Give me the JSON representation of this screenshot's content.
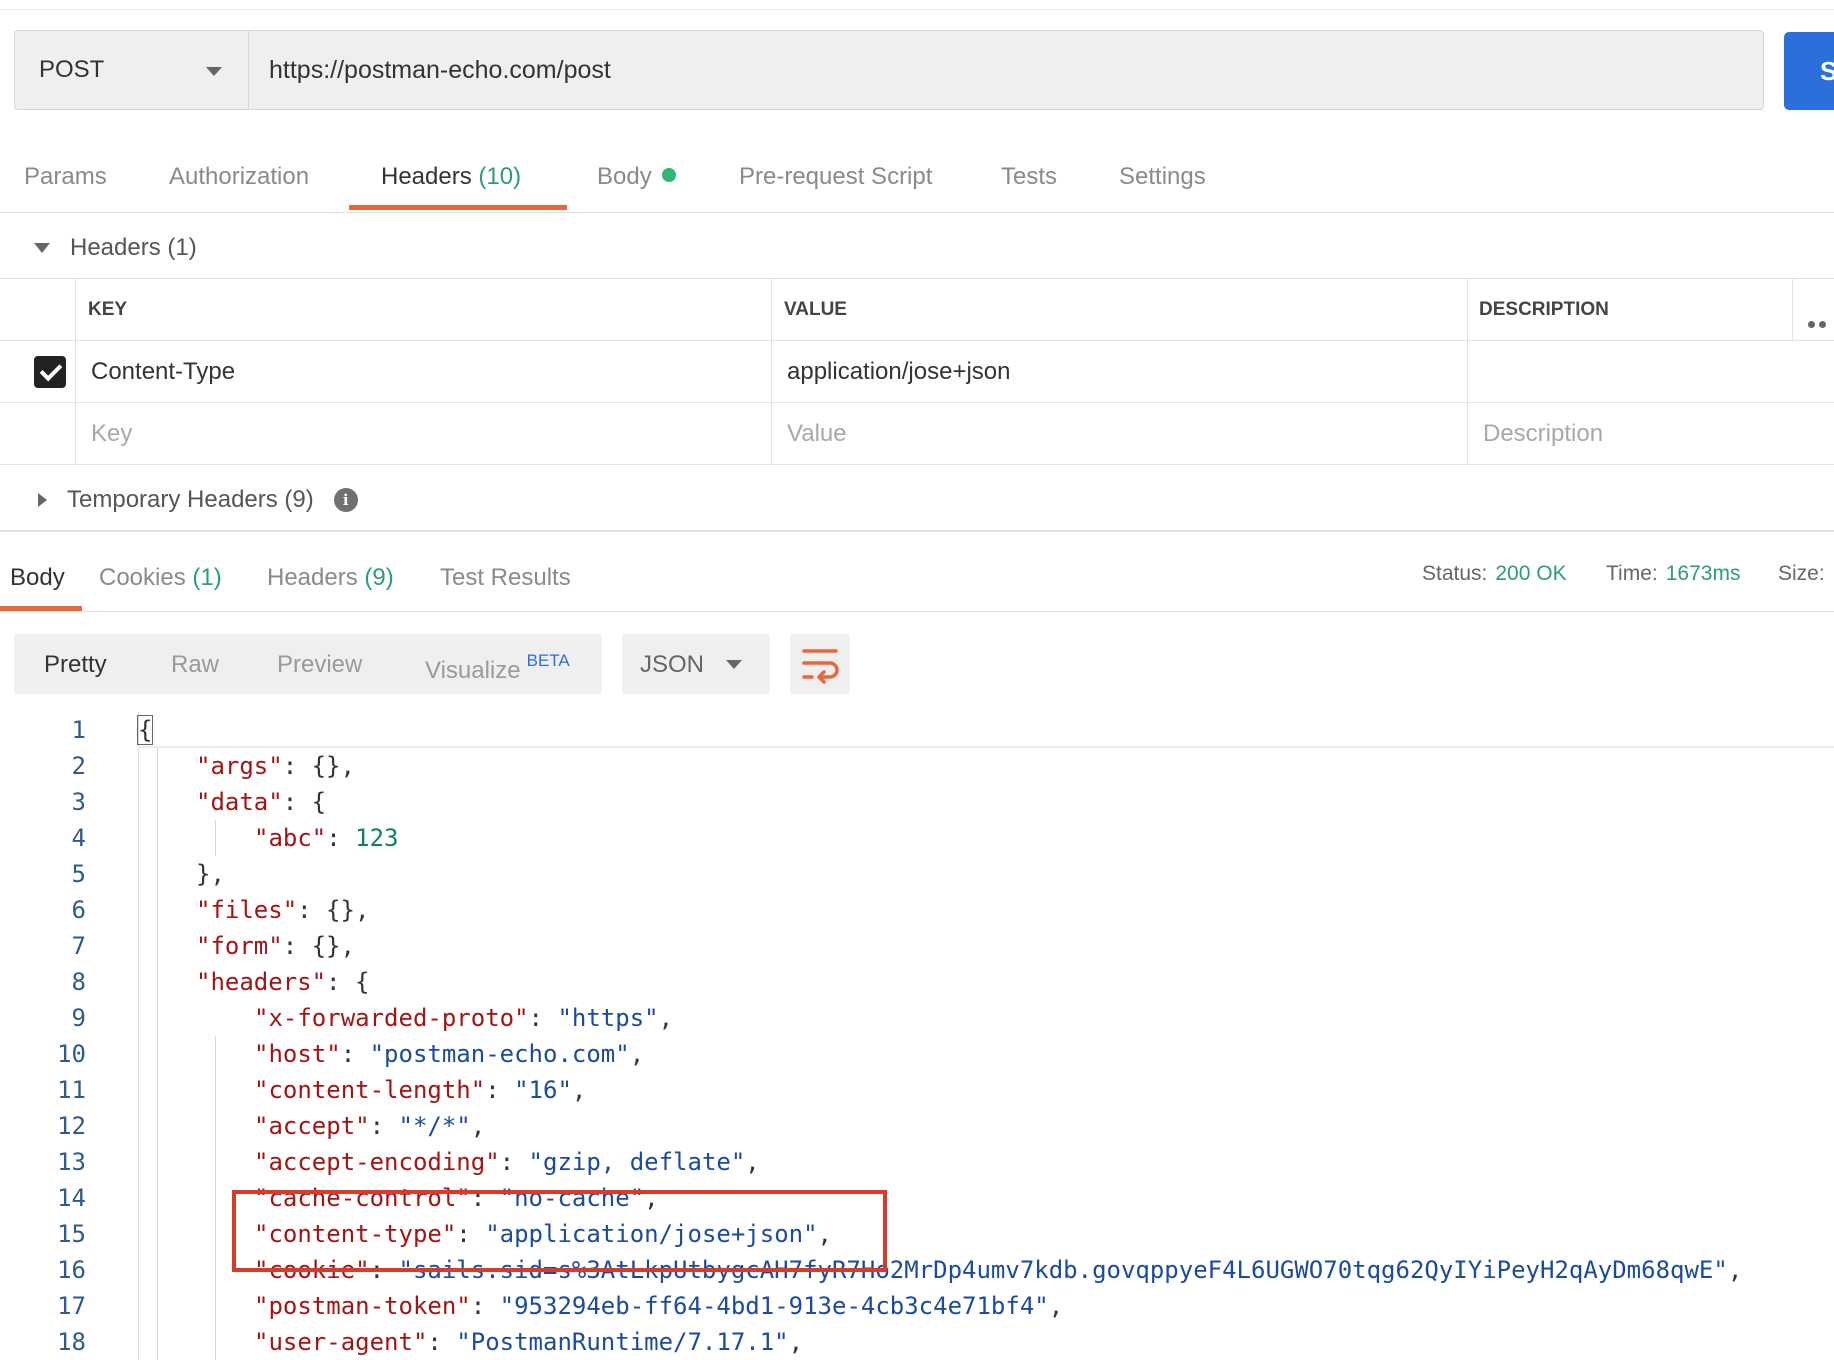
{
  "request": {
    "method": "POST",
    "url": "https://postman-echo.com/post",
    "send_label": "S"
  },
  "request_tabs": [
    {
      "label": "Params",
      "count": ""
    },
    {
      "label": "Authorization",
      "count": ""
    },
    {
      "label": "Headers",
      "count": "(10)"
    },
    {
      "label": "Body",
      "count": ""
    },
    {
      "label": "Pre-request Script",
      "count": ""
    },
    {
      "label": "Tests",
      "count": ""
    },
    {
      "label": "Settings",
      "count": ""
    }
  ],
  "headers_section": {
    "title": "Headers",
    "count": "(1)",
    "columns": [
      "KEY",
      "VALUE",
      "DESCRIPTION"
    ],
    "rows": [
      {
        "checked": true,
        "key": "Content-Type",
        "value": "application/jose+json",
        "description": ""
      }
    ],
    "placeholders": {
      "key": "Key",
      "value": "Value",
      "description": "Description"
    }
  },
  "temporary_headers": {
    "title": "Temporary Headers",
    "count": "(9)"
  },
  "response_tabs": [
    {
      "label": "Body",
      "count": ""
    },
    {
      "label": "Cookies",
      "count": "(1)"
    },
    {
      "label": "Headers",
      "count": "(9)"
    },
    {
      "label": "Test Results",
      "count": ""
    }
  ],
  "response_status": {
    "status_label": "Status:",
    "status_value": "200 OK",
    "time_label": "Time:",
    "time_value": "1673ms",
    "size_label": "Size:"
  },
  "body_modes": {
    "pretty": "Pretty",
    "raw": "Raw",
    "preview": "Preview",
    "visualize": "Visualize",
    "beta": "BETA"
  },
  "format": "JSON",
  "code_lines": [
    {
      "n": "1",
      "k": "",
      "v": "",
      "t": "{"
    },
    {
      "n": "2",
      "k": "\"args\"",
      "v": "",
      "t": ": {},"
    },
    {
      "n": "3",
      "k": "\"data\"",
      "v": "",
      "t": ": {"
    },
    {
      "n": "4",
      "k": "\"abc\"",
      "v": "123",
      "t": ""
    },
    {
      "n": "5",
      "k": "",
      "v": "",
      "t": "},"
    },
    {
      "n": "6",
      "k": "\"files\"",
      "v": "",
      "t": ": {},"
    },
    {
      "n": "7",
      "k": "\"form\"",
      "v": "",
      "t": ": {},"
    },
    {
      "n": "8",
      "k": "\"headers\"",
      "v": "",
      "t": ": {"
    },
    {
      "n": "9",
      "k": "\"x-forwarded-proto\"",
      "v": "\"https\"",
      "t": ","
    },
    {
      "n": "10",
      "k": "\"host\"",
      "v": "\"postman-echo.com\"",
      "t": ","
    },
    {
      "n": "11",
      "k": "\"content-length\"",
      "v": "\"16\"",
      "t": ","
    },
    {
      "n": "12",
      "k": "\"accept\"",
      "v": "\"*/*\"",
      "t": ","
    },
    {
      "n": "13",
      "k": "\"accept-encoding\"",
      "v": "\"gzip, deflate\"",
      "t": ","
    },
    {
      "n": "14",
      "k": "\"cache-control\"",
      "v": "\"no-cache\"",
      "t": ","
    },
    {
      "n": "15",
      "k": "\"content-type\"",
      "v": "\"application/jose+json\"",
      "t": ","
    },
    {
      "n": "16",
      "k": "\"cookie\"",
      "v": "\"sails.sid=s%3AtLkpUtbygcAH7fyR7Ho2MrDp4umv7kdb.govqppyeF4L6UGWO70tqg62QyIYiPeyH2qAyDm68qwE\"",
      "t": ","
    },
    {
      "n": "17",
      "k": "\"postman-token\"",
      "v": "\"953294eb-ff64-4bd1-913e-4cb3c4e71bf4\"",
      "t": ","
    },
    {
      "n": "18",
      "k": "\"user-agent\"",
      "v": "\"PostmanRuntime/7.17.1\"",
      "t": ","
    }
  ],
  "colors": {
    "accent": "#e5693c",
    "send": "#2b6fdb",
    "count_green": "#2d9e6e",
    "highlight_box": "#d93a2b"
  }
}
